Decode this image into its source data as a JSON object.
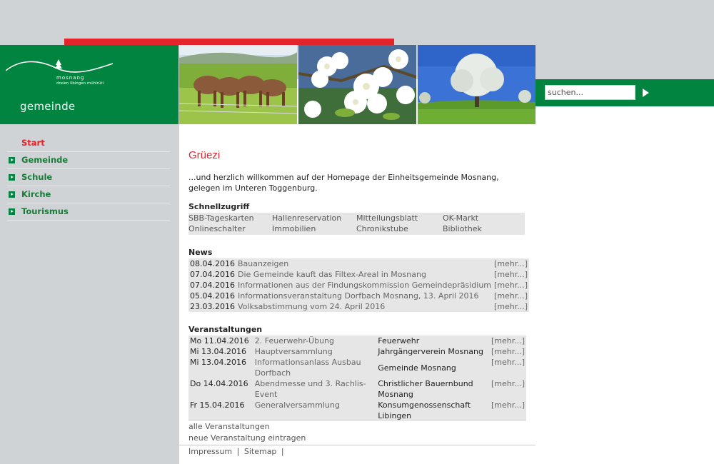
{
  "logo": {
    "name": "mosnang",
    "tagline": "dreien libingen mühlrüti",
    "word": "gemeinde"
  },
  "search": {
    "placeholder": "suchen..."
  },
  "nav": {
    "items": [
      {
        "label": "Start"
      },
      {
        "label": "Gemeinde"
      },
      {
        "label": "Schule"
      },
      {
        "label": "Kirche"
      },
      {
        "label": "Tourismus"
      }
    ]
  },
  "main": {
    "greeting": "Grüezi",
    "intro_line1": "...und herzlich willkommen auf der Homepage der Einheitsgemeinde Mosnang,",
    "intro_line2": "gelegen im Unteren Toggenburg.",
    "quick_title": "Schnellzugriff",
    "quick_links": [
      "SBB-Tageskarten",
      "Hallenreservation",
      "Mitteilungsblatt",
      "OK-Markt",
      "Onlineschalter",
      "Immobilien",
      "Chronikstube",
      "Bibliothek"
    ],
    "news_title": "News",
    "more_label": "[mehr...]",
    "news": [
      {
        "date": "08.04.2016",
        "title": "Bauanzeigen"
      },
      {
        "date": "07.04.2016",
        "title": "Die Gemeinde kauft das Filtex-Areal in Mosnang"
      },
      {
        "date": "07.04.2016",
        "title": "Informationen aus der Findungskommission Gemeindepräsidium"
      },
      {
        "date": "05.04.2016",
        "title": "Informationsveranstaltung Dorfbach Mosnang, 13. April 2016"
      },
      {
        "date": "23.03.2016",
        "title": "Volksabstimmung vom 24. April 2016"
      }
    ],
    "events_title": "Veranstaltungen",
    "events": [
      {
        "date": "Mo 11.04.2016",
        "title": "2. Feuerwehr-Übung",
        "org": "Feuerwehr"
      },
      {
        "date": "Mi  13.04.2016",
        "title": "Hauptversammlung",
        "org": "Jahrgängerverein Mosnang"
      },
      {
        "date": "Mi  13.04.2016",
        "title": "Informationsanlass Ausbau Dorfbach",
        "org": "Gemeinde Mosnang"
      },
      {
        "date": "Do 14.04.2016",
        "title": "Abendmesse und 3. Rachlis-Event",
        "org": "Christlicher Bauernbund Mosnang"
      },
      {
        "date": "Fr  15.04.2016",
        "title": "Generalversammlung",
        "org": "Konsumgenossenschaft Libingen"
      }
    ],
    "all_events": "alle Veranstaltungen",
    "add_event": "neue Veranstaltung eintragen"
  },
  "footer": {
    "impressum": "Impressum",
    "sitemap": "Sitemap",
    "separator": "|"
  },
  "colors": {
    "green": "#00843f",
    "red": "#e3242b",
    "gray": "#d0d3d6"
  }
}
